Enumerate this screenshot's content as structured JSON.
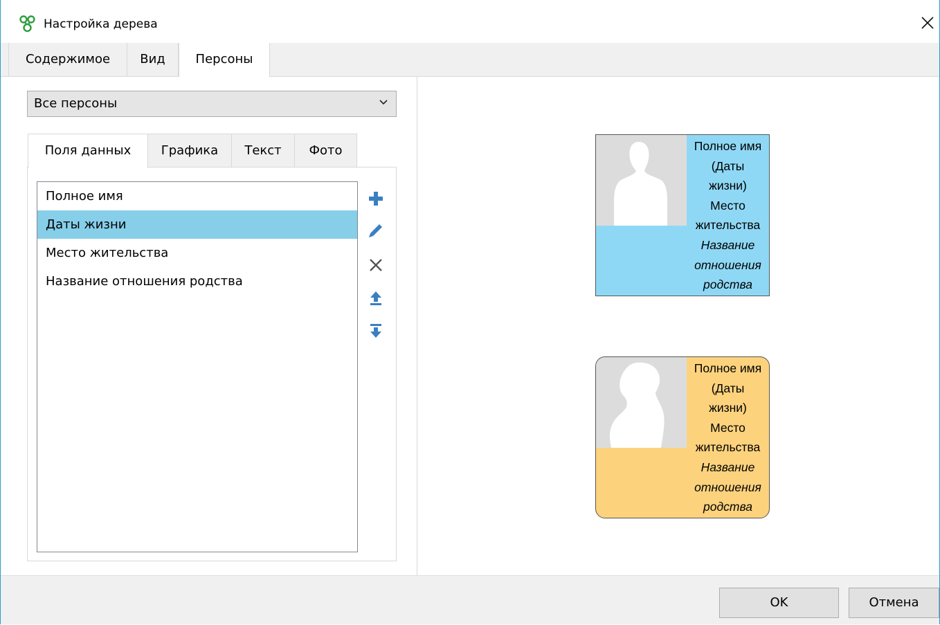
{
  "window": {
    "title": "Настройка дерева",
    "icon": "family-tree-app-icon",
    "close_icon": "close-icon"
  },
  "main_tabs": [
    {
      "label": "Содержимое",
      "active": false
    },
    {
      "label": "Вид",
      "active": false
    },
    {
      "label": "Персоны",
      "active": true
    }
  ],
  "person_filter": {
    "selected": "Все персоны",
    "icon": "chevron-down-icon"
  },
  "sub_tabs": [
    {
      "label": "Поля данных",
      "active": true
    },
    {
      "label": "Графика",
      "active": false
    },
    {
      "label": "Текст",
      "active": false
    },
    {
      "label": "Фото",
      "active": false
    }
  ],
  "data_fields": {
    "items": [
      "Полное имя",
      "Даты жизни",
      "Место жительства",
      "Название отношения родства"
    ],
    "selected_index": 1,
    "selection_color": "#87cee9"
  },
  "field_actions": [
    {
      "icon": "add-icon",
      "color": "#3a7fc1"
    },
    {
      "icon": "edit-icon",
      "color": "#3a7fc1"
    },
    {
      "icon": "delete-icon",
      "color": "#555555"
    },
    {
      "icon": "move-up-icon",
      "color": "#3a7fc1"
    },
    {
      "icon": "move-down-icon",
      "color": "#3a7fc1"
    }
  ],
  "preview": {
    "male_card": {
      "color": "#8fd8f5",
      "lines": [
        "Полное имя",
        "(Даты",
        "жизни)",
        "Место",
        "жительства"
      ],
      "italic_lines": [
        "Название",
        "отношения",
        "родства"
      ]
    },
    "female_card": {
      "color": "#fcd27d",
      "lines": [
        "Полное имя",
        "(Даты",
        "жизни)",
        "Место",
        "жительства"
      ],
      "italic_lines": [
        "Название",
        "отношения",
        "родства"
      ]
    }
  },
  "footer": {
    "ok_label": "OK",
    "cancel_label": "Отмена"
  }
}
